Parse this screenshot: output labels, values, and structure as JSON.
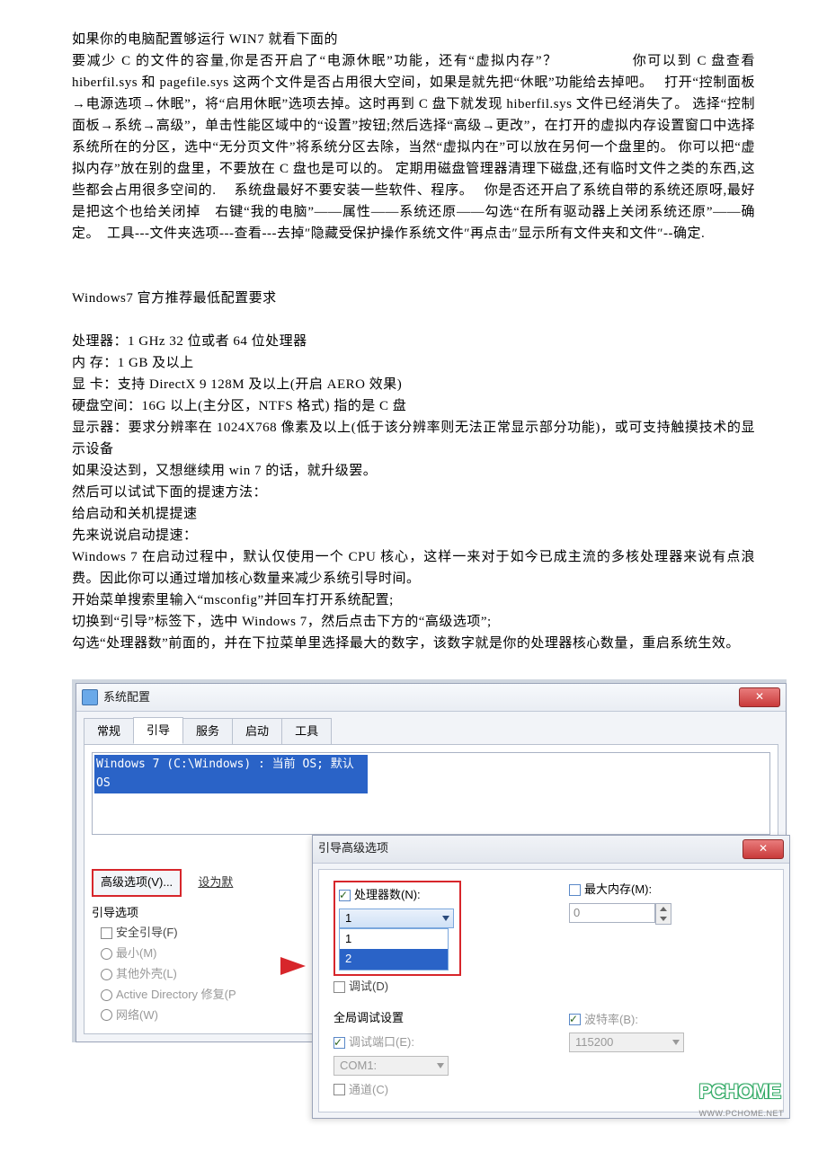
{
  "text": {
    "p1": "如果你的电脑配置够运行 WIN7 就看下面的",
    "p2": "要减少 C 的文件的容量,你是否开启了“电源休眠”功能，还有“虚拟内存”？　　　　　你可以到 C 盘查看 hiberfil.sys 和 pagefile.sys 这两个文件是否占用很大空间，如果是就先把“休眠”功能给去掉吧。　 打开“控制面板→电源选项→休眠”，将“启用休眠”选项去掉。这时再到 C 盘下就发现 hiberfil.sys 文件已经消失了。 选择“控制面板→系统→高级”，单击性能区域中的“设置”按钮;然后选择“高级→更改”，在打开的虚拟内存设置窗口中选择系统所在的分区，选中“无分页文件”将系统分区去除，当然“虚拟内在”可以放在另何一个盘里的。 你可以把“虚拟内存”放在别的盘里，不要放在 C 盘也是可以的。 定期用磁盘管理器清理下磁盘,还有临时文件之类的东西,这些都会占用很多空间的.　 系统盘最好不要安装一些软件、程序。　 你是否还开启了系统自带的系统还原呀,最好是把这个也给关闭掉　右键“我的电脑”——属性——系统还原——勾选“在所有驱动器上关闭系统还原”——确定。　工具---文件夹选项---查看---去掉″隐藏受保护操作系统文件″再点击″显示所有文件夹和文件″--确定.",
    "p3": "Windows7 官方推荐最低配置要求",
    "p4": "处理器：1 GHz 32 位或者 64 位处理器",
    "p5": "内 存：1 GB 及以上",
    "p6": "显 卡：支持 DirectX 9 128M 及以上(开启 AERO 效果)",
    "p7": "硬盘空间：16G 以上(主分区，NTFS 格式) 指的是 C 盘",
    "p8": "显示器：要求分辨率在 1024X768 像素及以上(低于该分辨率则无法正常显示部分功能)，或可支持触摸技术的显示设备",
    "p9": "如果没达到，又想继续用 win 7 的话，就升级罢。",
    "p10": "然后可以试试下面的提速方法：",
    "p11": "给启动和关机提提速",
    "p12": "先来说说启动提速：",
    "p13": "Windows 7 在启动过程中，默认仅使用一个 CPU 核心，这样一来对于如今已成主流的多核处理器来说有点浪费。因此你可以通过增加核心数量来减少系统引导时间。",
    "p14": "开始菜单搜索里输入“msconfig”并回车打开系统配置;",
    "p15": "切换到“引导”标签下，选中 Windows 7，然后点击下方的“高级选项”;",
    "p16": "勾选“处理器数”前面的，并在下拉菜单里选择最大的数字，该数字就是你的处理器核心数量，重启系统生效。"
  },
  "screenshot": {
    "window_title": "系统配置",
    "close_x": "✕",
    "tabs": [
      "常规",
      "引导",
      "服务",
      "启动",
      "工具"
    ],
    "active_tab": 1,
    "boot_entry": "Windows 7 (C:\\Windows) : 当前 OS; 默认 OS",
    "adv_button": "高级选项(V)...",
    "set_default": "设为默",
    "boot_group": "引导选项",
    "safe_boot": "安全引导(F)",
    "opt_min": "最小(M)",
    "opt_shell": "其他外壳(L)",
    "opt_ad": "Active Directory 修复(P",
    "opt_net": "网络(W)",
    "child_title": "引导高级选项",
    "proc_label": "处理器数(N):",
    "proc_selected": "1",
    "proc_options": [
      "1",
      "2"
    ],
    "maxmem_label": "最大内存(M):",
    "maxmem_value": "0",
    "debug_label": "调试(D)",
    "global_title": "全局调试设置",
    "debug_port_label": "调试端口(E):",
    "debug_port_value": "COM1:",
    "baud_label": "波特率(B):",
    "baud_value": "115200",
    "channel_label": "通道(C)",
    "watermark": "PCHOME",
    "watermark_sub": "WWW.PCHOME.NET"
  }
}
